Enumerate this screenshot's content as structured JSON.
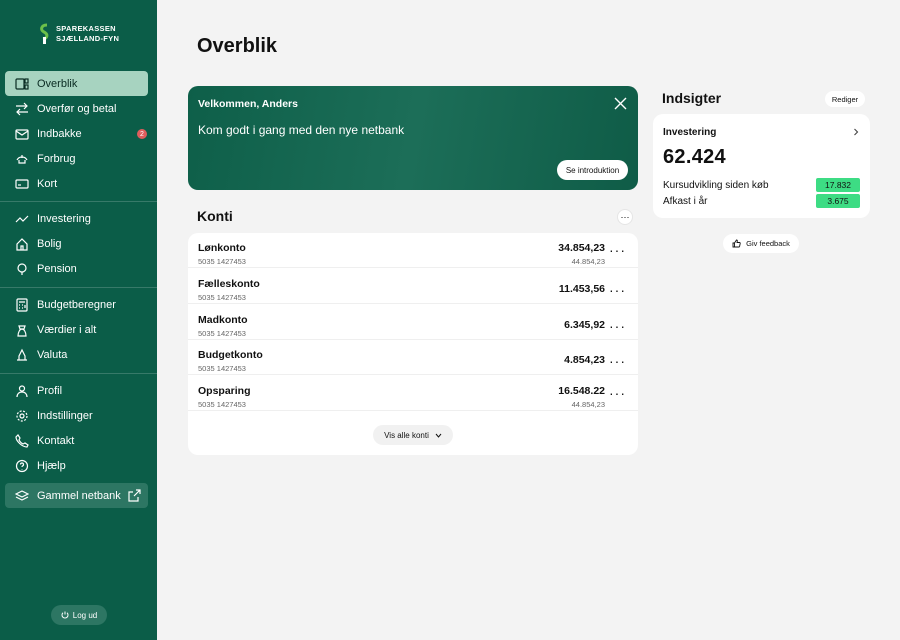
{
  "brand": {
    "line1": "SPAREKASSEN",
    "line2": "SJÆLLAND-FYN",
    "logo_icon": "sparekassen-logo-icon"
  },
  "sidebar": {
    "items": [
      {
        "label": "Overblik",
        "icon": "dashboard-icon",
        "active": true
      },
      {
        "label": "Overfør og betal",
        "icon": "transfer-arrows-icon"
      },
      {
        "label": "Indbakke",
        "icon": "mail-icon",
        "badge": "2"
      },
      {
        "label": "Forbrug",
        "icon": "spending-icon"
      },
      {
        "label": "Kort",
        "icon": "card-icon"
      },
      {
        "label": "Investering",
        "icon": "trend-icon"
      },
      {
        "label": "Bolig",
        "icon": "home-icon"
      },
      {
        "label": "Pension",
        "icon": "pension-icon"
      },
      {
        "label": "Budgetberegner",
        "icon": "calculator-icon"
      },
      {
        "label": "Værdier i alt",
        "icon": "values-icon"
      },
      {
        "label": "Valuta",
        "icon": "currency-icon"
      },
      {
        "label": "Profil",
        "icon": "user-icon"
      },
      {
        "label": "Indstillinger",
        "icon": "gear-icon"
      },
      {
        "label": "Kontakt",
        "icon": "phone-icon"
      },
      {
        "label": "Hjælp",
        "icon": "help-icon"
      },
      {
        "label": "Gammel netbank",
        "icon": "layers-icon",
        "external": true
      }
    ],
    "logout_label": "Log ud"
  },
  "main": {
    "title": "Overblik",
    "welcome": {
      "title": "Velkommen, Anders",
      "text": "Kom godt i gang med den nye netbank",
      "button": "Se introduktion"
    },
    "accounts_title": "Konti",
    "accounts": [
      {
        "name": "Lønkonto",
        "number": "5035 1427453",
        "balance": "34.854,23",
        "available": "44.854,23"
      },
      {
        "name": "Fælleskonto",
        "number": "5035 1427453",
        "balance": "11.453,56"
      },
      {
        "name": "Madkonto",
        "number": "5035 1427453",
        "balance": "6.345,92"
      },
      {
        "name": "Budgetkonto",
        "number": "5035 1427453",
        "balance": "4.854,23"
      },
      {
        "name": "Opsparing",
        "number": "5035 1427453",
        "balance": "16.548.22",
        "available": "44.854,23"
      }
    ],
    "show_all_label": "Vis alle konti"
  },
  "insights": {
    "title": "Indsigter",
    "edit_label": "Rediger",
    "card": {
      "label": "Investering",
      "value": "62.424",
      "rows": [
        {
          "label": "Kursudvikling siden køb",
          "value": "17.832"
        },
        {
          "label": "Afkast i år",
          "value": "3.675"
        }
      ]
    },
    "feedback_label": "Giv feedback"
  },
  "colors": {
    "sidebar": "#0b5d48",
    "active_nav": "#a7d3c0",
    "positive": "#3ddc84",
    "badge": "#e05d5d"
  }
}
